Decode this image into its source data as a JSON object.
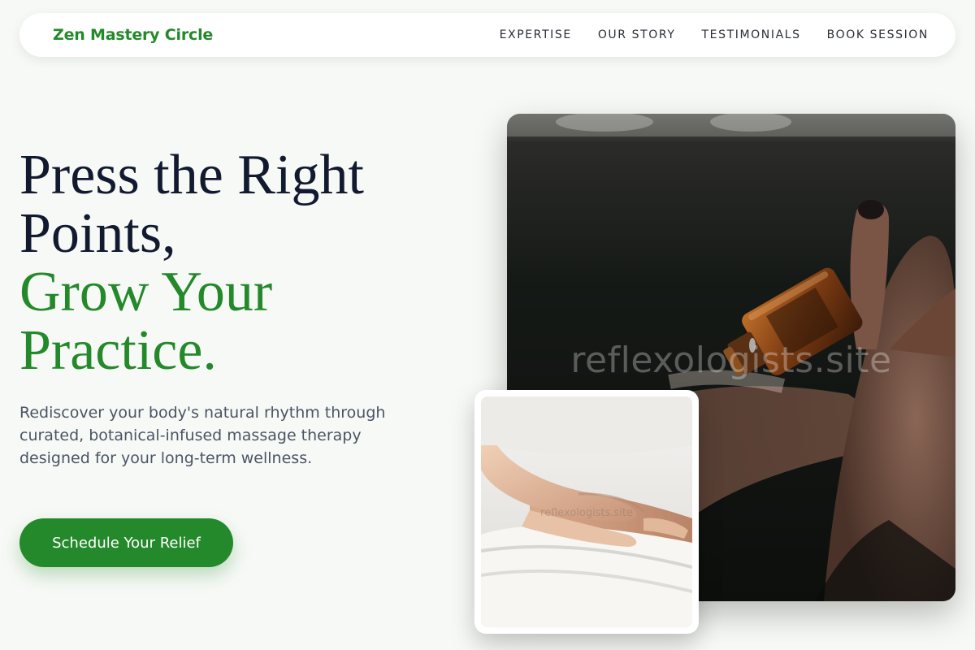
{
  "nav": {
    "brand": "Zen Mastery Circle",
    "links": [
      {
        "label": "EXPERTISE"
      },
      {
        "label": "OUR STORY"
      },
      {
        "label": "TESTIMONIALS"
      },
      {
        "label": "BOOK SESSION"
      }
    ]
  },
  "hero": {
    "title_line1": "Press the Right",
    "title_line2": "Points,",
    "title_line3": "Grow Your",
    "title_line4": "Practice.",
    "subtitle": "Rediscover your body's natural rhythm through curated, botanical-infused massage therapy designed for your long-term wellness.",
    "cta_label": "Schedule Your Relief"
  },
  "images": {
    "main_watermark": "reflexologists.site",
    "inset_watermark": "reflexologists.site"
  },
  "colors": {
    "brand_green": "#24892a",
    "heading_dark": "#121a30",
    "background": "#f7f9f6"
  }
}
